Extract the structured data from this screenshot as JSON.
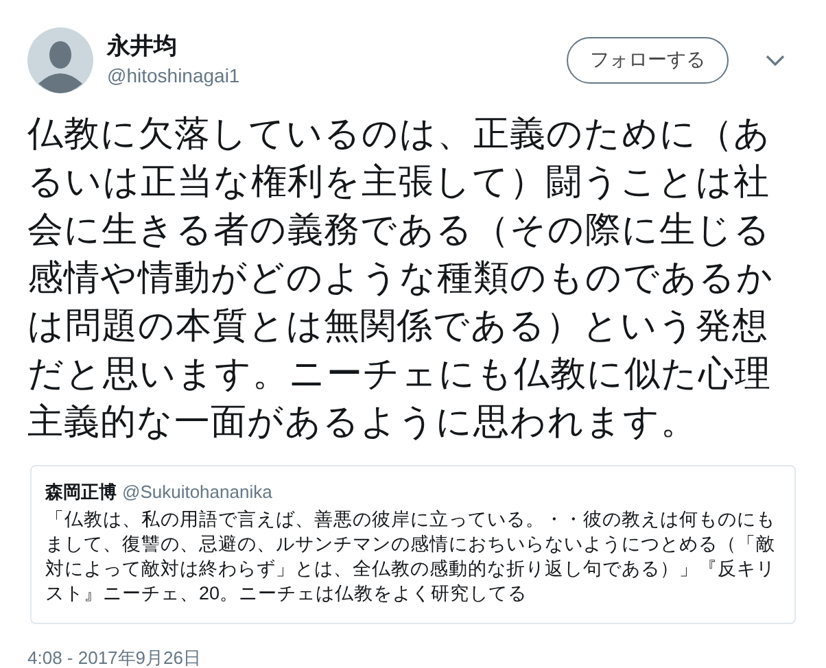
{
  "author": {
    "name": "永井均",
    "handle": "@hitoshinagai1"
  },
  "follow_button": "フォローする",
  "text": "仏教に欠落しているのは、正義のために（あるいは正当な権利を主張して）闘うことは社会に生きる者の義務である（その際に生じる感情や情動がどのような種類のものであるかは問題の本質とは無関係である）という発想だと思います。ニーチェにも仏教に似た心理主義的な一面があるように思われます。",
  "quoted_tweet": {
    "name": "森岡正博",
    "handle": "@Sukuitohananika",
    "text": "「仏教は、私の用語で言えば、善悪の彼岸に立っている。・・彼の教えは何ものにもまして、復讐の、忌避の、ルサンチマンの感情におちいらないようにつとめる（「敵対によって敵対は終わらず」とは、全仏教の感動的な折り返し句である）」『反キリスト』ニーチェ、20。ニーチェは仏教をよく研究してる"
  },
  "timestamp": "4:08 - 2017年9月26日"
}
